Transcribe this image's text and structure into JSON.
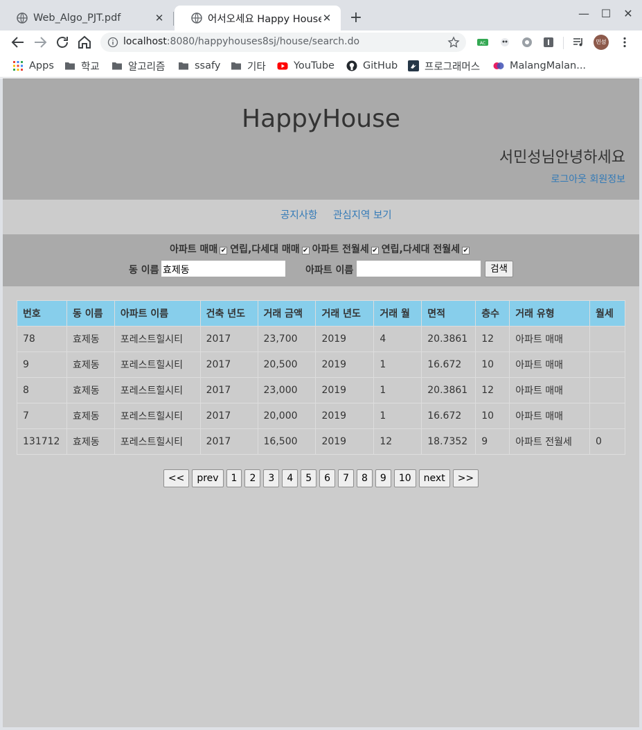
{
  "browser": {
    "tabs": [
      {
        "title": "Web_Algo_PJT.pdf",
        "active": false
      },
      {
        "title": "어서오세요 Happy House",
        "active": true
      }
    ],
    "new_tab": "+",
    "window_controls": {
      "minimize": "—",
      "maximize": "☐",
      "close": "✕"
    },
    "url_host": "localhost",
    "url_path": ":8080/happyhouses8sj/house/search.do",
    "profile_initials": "민성",
    "bookmarks": [
      {
        "label": "Apps",
        "icon": "apps-grid-icon"
      },
      {
        "label": "학교",
        "icon": "folder-icon"
      },
      {
        "label": "알고리즘",
        "icon": "folder-icon"
      },
      {
        "label": "ssafy",
        "icon": "folder-icon"
      },
      {
        "label": "기타",
        "icon": "folder-icon"
      },
      {
        "label": "YouTube",
        "icon": "youtube-icon"
      },
      {
        "label": "GitHub",
        "icon": "github-icon"
      },
      {
        "label": "프로그래머스",
        "icon": "programmers-icon"
      },
      {
        "label": "MalangMalan...",
        "icon": "malang-icon"
      }
    ]
  },
  "site": {
    "title": "HappyHouse",
    "greeting": "서민성님안녕하세요",
    "logout_link": "로그아웃",
    "member_info_link": "회원정보"
  },
  "nav": {
    "notice": "공지사항",
    "interest_area": "관심지역 보기"
  },
  "filters": {
    "apt_sale": {
      "label": "아파트 매매",
      "checked": true
    },
    "villa_sale": {
      "label": "연립,다세대 매매",
      "checked": true
    },
    "apt_rent": {
      "label": "아파트 전월세",
      "checked": true
    },
    "villa_rent": {
      "label": "연립,다세대 전월세",
      "checked": true
    }
  },
  "search": {
    "dong_label": "동 이름",
    "dong_value": "효제동",
    "apt_label": "아파트 이름",
    "apt_value": "",
    "button": "검색"
  },
  "table": {
    "headers": [
      "번호",
      "동 이름",
      "아파트 이름",
      "건축 년도",
      "거래 금액",
      "거래 년도",
      "거래 월",
      "면적",
      "층수",
      "거래 유형",
      "월세"
    ],
    "rows": [
      [
        "78",
        "효제동",
        "포레스트힐시티",
        "2017",
        "23,700",
        "2019",
        "4",
        "20.3861",
        "12",
        "아파트 매매",
        ""
      ],
      [
        "9",
        "효제동",
        "포레스트힐시티",
        "2017",
        "20,500",
        "2019",
        "1",
        "16.672",
        "10",
        "아파트 매매",
        ""
      ],
      [
        "8",
        "효제동",
        "포레스트힐시티",
        "2017",
        "23,000",
        "2019",
        "1",
        "20.3861",
        "12",
        "아파트 매매",
        ""
      ],
      [
        "7",
        "효제동",
        "포레스트힐시티",
        "2017",
        "20,000",
        "2019",
        "1",
        "16.672",
        "10",
        "아파트 매매",
        ""
      ],
      [
        "131712",
        "효제동",
        "포레스트힐시티",
        "2017",
        "16,500",
        "2019",
        "12",
        "18.7352",
        "9",
        "아파트 전월세",
        "0"
      ]
    ]
  },
  "pagination": {
    "first": "<<",
    "prev": "prev",
    "pages": [
      "1",
      "2",
      "3",
      "4",
      "5",
      "6",
      "7",
      "8",
      "9",
      "10"
    ],
    "next": "next",
    "last": ">>"
  },
  "colors": {
    "header_bg": "#aaaaaa",
    "page_bg": "#cccccc",
    "table_header_bg": "#87ceeb",
    "link": "#337ab7"
  }
}
